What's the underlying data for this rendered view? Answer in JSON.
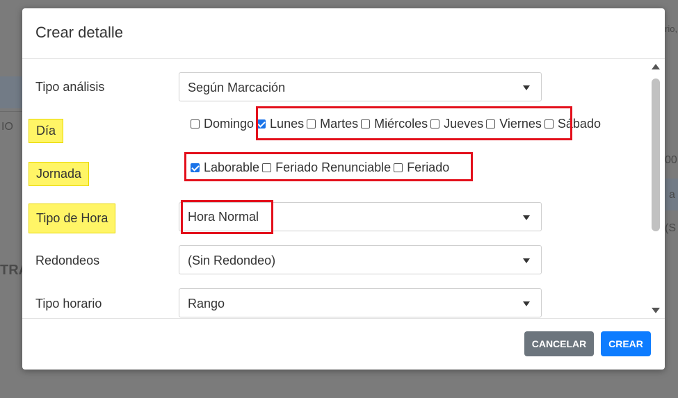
{
  "background": {
    "fragments": [
      "rio,",
      "IO",
      "TRA",
      "00",
      "a",
      "(S"
    ]
  },
  "modal": {
    "title": "Crear detalle",
    "fields": {
      "tipo_analisis": {
        "label": "Tipo análisis",
        "value": "Según Marcación"
      },
      "dia": {
        "label": "Día",
        "options": [
          {
            "label": "Domingo",
            "checked": false
          },
          {
            "label": "Lunes",
            "checked": true
          },
          {
            "label": "Martes",
            "checked": false
          },
          {
            "label": "Miércoles",
            "checked": false
          },
          {
            "label": "Jueves",
            "checked": false
          },
          {
            "label": "Viernes",
            "checked": false
          },
          {
            "label": "Sábado",
            "checked": false
          }
        ]
      },
      "jornada": {
        "label": "Jornada",
        "options": [
          {
            "label": "Laborable",
            "checked": true
          },
          {
            "label": "Feriado Renunciable",
            "checked": false
          },
          {
            "label": "Feriado",
            "checked": false
          }
        ]
      },
      "tipo_hora": {
        "label": "Tipo de Hora",
        "value": "Hora Normal"
      },
      "redondeos": {
        "label": "Redondeos",
        "value": "(Sin Redondeo)"
      },
      "tipo_horario": {
        "label": "Tipo horario",
        "value": "Rango"
      }
    },
    "buttons": {
      "cancel": "CANCELAR",
      "create": "CREAR"
    }
  },
  "colors": {
    "highlight": "#fff566",
    "annotation_box": "#e3101c",
    "checkbox_checked": "#1a73e8",
    "cancel_button": "#6c757d",
    "create_button": "#0d7cff"
  }
}
